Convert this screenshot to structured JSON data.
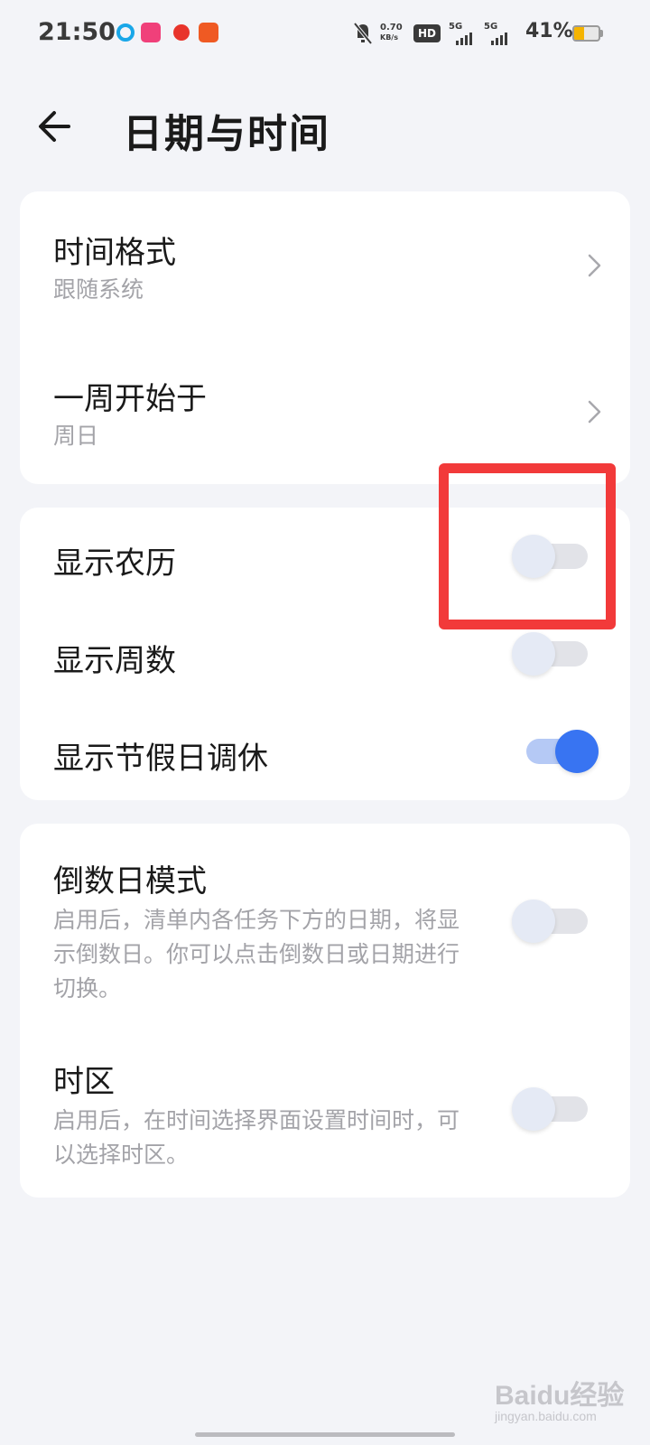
{
  "status_bar": {
    "time": "21:50",
    "net_speed_value": "0.70",
    "net_speed_unit": "KB/s",
    "hd_label": "HD",
    "sim1_network": "5G",
    "sim2_network": "5G",
    "battery_percent_text": "41%",
    "battery_level": 0.41,
    "app_icons": [
      "blue-ring-app-icon",
      "pink-app-icon",
      "red-app-icon",
      "orange-app-icon"
    ]
  },
  "header": {
    "title": "日期与时间"
  },
  "card_general": {
    "items": [
      {
        "title": "时间格式",
        "subtitle": "跟随系统"
      },
      {
        "title": "一周开始于",
        "subtitle": "周日"
      }
    ]
  },
  "card_display": {
    "items": [
      {
        "title": "显示农历",
        "enabled": false
      },
      {
        "title": "显示周数",
        "enabled": false
      },
      {
        "title": "显示节假日调休",
        "enabled": true
      }
    ]
  },
  "card_advanced": {
    "items": [
      {
        "title": "倒数日模式",
        "description": "启用后，清单内各任务下方的日期，将显示倒数日。你可以点击倒数日或日期进行切换。",
        "enabled": false
      },
      {
        "title": "时区",
        "description": "启用后，在时间选择界面设置时间时，可以选择时区。",
        "enabled": false
      }
    ]
  },
  "watermark": {
    "main": "Baidu经验",
    "sub": "jingyan.baidu.com"
  },
  "colors": {
    "background": "#f3f4f8",
    "accent": "#3874f2",
    "highlight": "#f23a3a",
    "battery": "#f5b400"
  }
}
